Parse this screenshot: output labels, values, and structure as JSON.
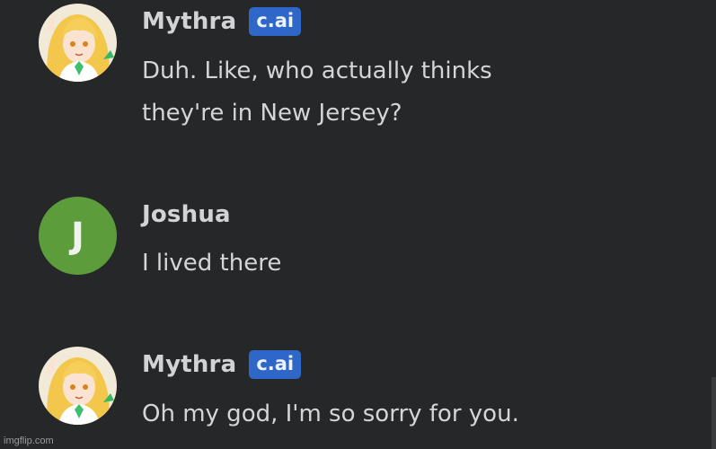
{
  "messages": [
    {
      "author": "Mythra",
      "badge": "c.ai",
      "avatar": "mythra-avatar-image",
      "lines": [
        "Duh. Like, who actually thinks",
        "they're in New Jersey?"
      ]
    },
    {
      "author": "Joshua",
      "avatar_letter": "J",
      "avatar_color": "#5c9c3a",
      "lines": [
        "I lived there"
      ]
    },
    {
      "author": "Mythra",
      "badge": "c.ai",
      "avatar": "mythra-avatar-image",
      "lines": [
        "Oh my god, I'm so sorry for you."
      ]
    }
  ],
  "colors": {
    "background": "#262728",
    "badge": "#2f67c8",
    "text": "#d4d5d6"
  },
  "watermark": "imgflip.com"
}
